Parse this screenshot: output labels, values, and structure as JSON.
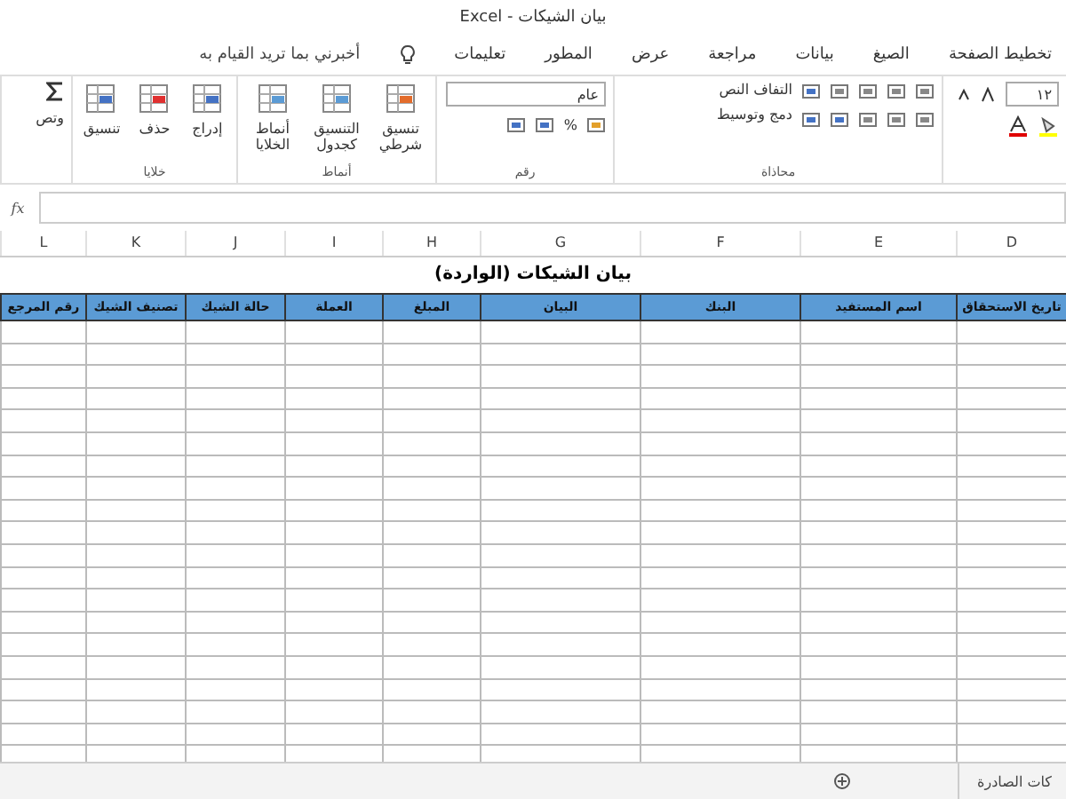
{
  "window": {
    "title": "بيان الشيكات  -  Excel"
  },
  "ribbon_tabs": [
    "تخطيط الصفحة",
    "الصيغ",
    "بيانات",
    "مراجعة",
    "عرض",
    "المطور",
    "تعليمات"
  ],
  "tell_me": "أخبرني بما تريد القيام به",
  "font_group": {
    "size": "١٢"
  },
  "alignment_group": {
    "label": "محاذاة",
    "wrap_text": "التفاف النص",
    "merge": "دمج وتوسيط"
  },
  "number_group": {
    "label": "رقم",
    "format": "عام",
    "percent": "%"
  },
  "styles_group": {
    "label": "أنماط",
    "buttons": [
      "تنسيق شرطي",
      "التنسيق كجدول",
      "أنماط الخلايا"
    ]
  },
  "cells_group": {
    "label": "خلايا",
    "buttons": [
      "إدراج",
      "حذف",
      "تنسيق"
    ]
  },
  "editing_group": {
    "partial": "وتص"
  },
  "formula_bar": {
    "fx": "fx"
  },
  "columns": [
    "D",
    "E",
    "F",
    "G",
    "H",
    "I",
    "J",
    "K",
    "L"
  ],
  "sheet": {
    "title": "بيان الشيكات (الواردة)",
    "headers": [
      "تاريخ الاستحقاق",
      "اسم المستفيد",
      "البنك",
      "البيان",
      "المبلغ",
      "العملة",
      "حالة الشيك",
      "تصنيف الشيك",
      "رقم المرجع"
    ]
  },
  "sheet_tabs": [
    "كات الصادرة"
  ]
}
